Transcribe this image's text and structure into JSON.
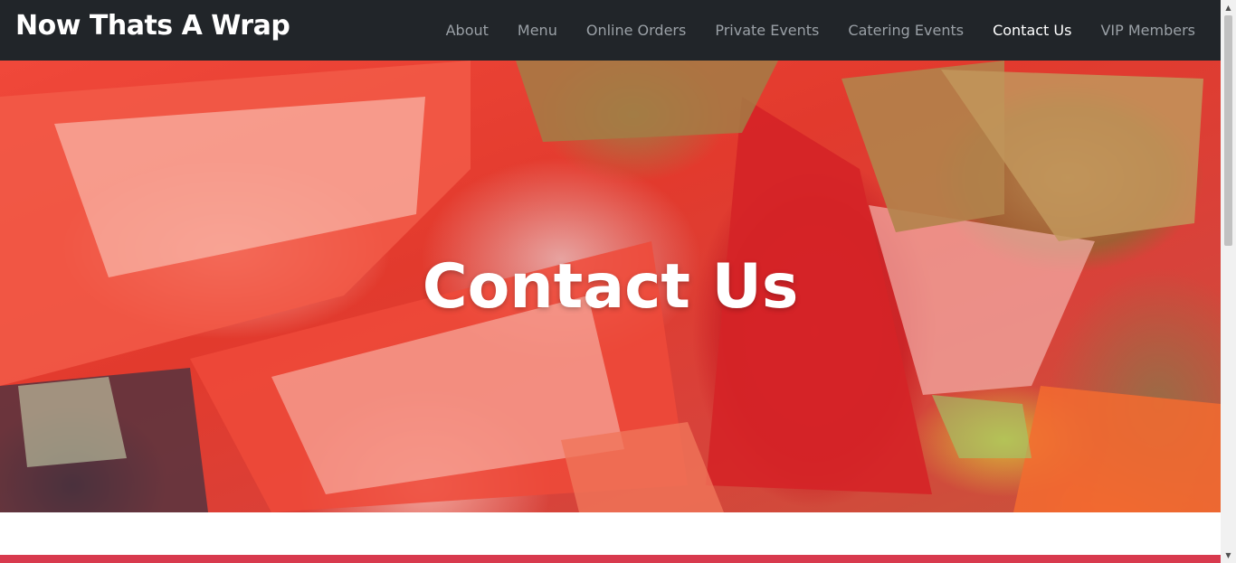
{
  "brand": "Now Thats A Wrap",
  "nav": [
    {
      "label": "About"
    },
    {
      "label": "Menu"
    },
    {
      "label": "Online Orders"
    },
    {
      "label": "Private Events"
    },
    {
      "label": "Catering Events"
    },
    {
      "label": "Contact Us",
      "active": true
    },
    {
      "label": "VIP Members"
    }
  ],
  "hero": {
    "title": "Contact Us"
  },
  "colors": {
    "navbar": "#212529",
    "nav_text": "#9aa0a6",
    "nav_active": "#ffffff",
    "accent_bar": "#d83a4e"
  },
  "icons": {
    "scroll_up": "triangle-up",
    "scroll_down": "triangle-down"
  }
}
